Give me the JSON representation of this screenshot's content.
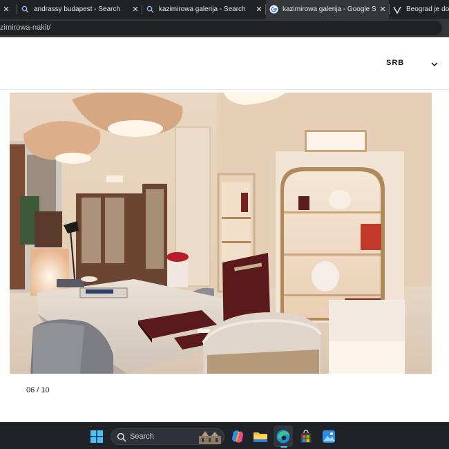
{
  "browser": {
    "tabs": [
      {
        "title": "",
        "partial": true
      },
      {
        "title": "andrassy budapest - Search"
      },
      {
        "title": "kazimirowa galerija - Search"
      },
      {
        "title": "kazimirowa galerija - Google Search"
      },
      {
        "title": "Beograd je dobi"
      }
    ],
    "url": "zimirowa-nakit/"
  },
  "header": {
    "language": "SRB"
  },
  "gallery": {
    "counter": "06 / 10"
  },
  "taskbar": {
    "search_placeholder": "Search"
  },
  "colors": {
    "tab_strip": "#202124",
    "active_tab": "#35363a",
    "taskbar": "#1f2227",
    "wall": "#e8d3bd",
    "walnut": "#6b4532",
    "burgundy": "#5a1a1c",
    "brass": "#b08a5a"
  }
}
